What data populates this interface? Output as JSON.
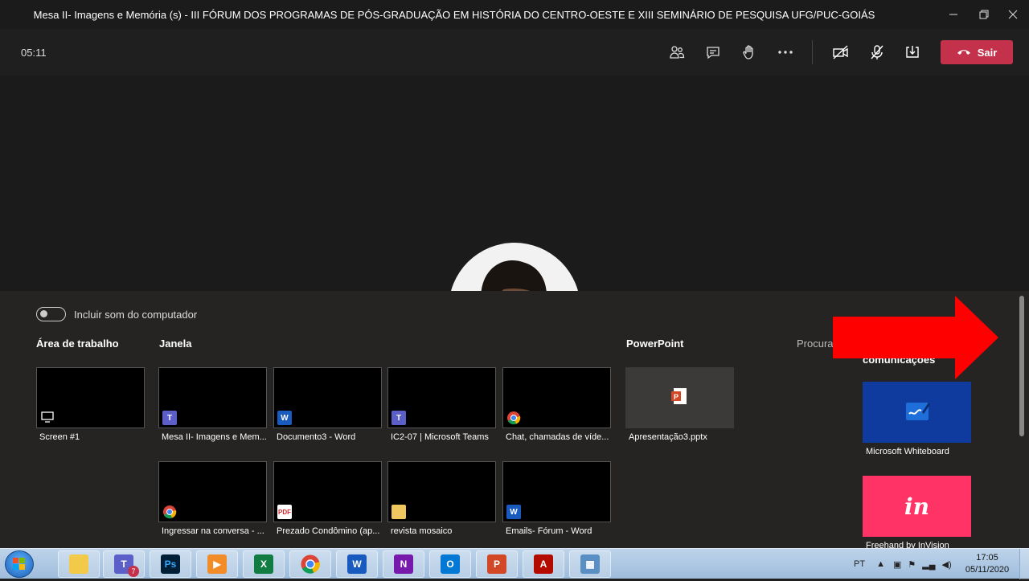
{
  "window": {
    "title": "Mesa II- Imagens e Memória (s) - III FÓRUM DOS PROGRAMAS DE PÓS-GRADUAÇÃO EM HISTÓRIA DO CENTRO-OESTE E XIII SEMINÁRIO DE PESQUISA UFG/PUC-GOIÁS"
  },
  "toolbar": {
    "timer": "05:11",
    "leave_label": "Sair",
    "icons": [
      "participants-icon",
      "chat-icon",
      "raise-hand-icon",
      "more-options-icon",
      "camera-off-icon",
      "mic-off-icon",
      "share-tray-icon"
    ]
  },
  "tray": {
    "include_sound_label": "Incluir som do computador",
    "desktop_label": "Área de trabalho",
    "window_label": "Janela",
    "powerpoint_label": "PowerPoint",
    "browse_label": "Procurar",
    "comm_label": "comunicações",
    "desktop_tiles": [
      {
        "caption": "Screen #1"
      }
    ],
    "window_tiles": [
      {
        "caption": "Mesa II- Imagens e Mem...",
        "app": "teams"
      },
      {
        "caption": "Documento3 - Word",
        "app": "word"
      },
      {
        "caption": "IC2-07 | Microsoft Teams",
        "app": "teams"
      },
      {
        "caption": "Chat, chamadas de víde...",
        "app": "chrome"
      },
      {
        "caption": "Ingressar na conversa - ...",
        "app": "chrome"
      },
      {
        "caption": "Prezado Condômino (ap...",
        "app": "pdf"
      },
      {
        "caption": "revista mosaico",
        "app": "folder"
      },
      {
        "caption": "Emails- Fórum - Word",
        "app": "word"
      }
    ],
    "ppt_tile": {
      "caption": "Apresentação3.pptx"
    },
    "apps": [
      {
        "caption": "Microsoft Whiteboard",
        "color": "#0f3a9e"
      },
      {
        "caption": "Freehand by InVision",
        "color": "#ff3366",
        "logo": "in"
      }
    ]
  },
  "taskbar": {
    "lang": "PT",
    "time": "17:05",
    "date": "05/11/2020",
    "teams_badge": "7",
    "apps": [
      "file-explorer",
      "teams",
      "photoshop",
      "media-player",
      "excel",
      "chrome",
      "word",
      "onenote",
      "outlook",
      "powerpoint",
      "acrobat",
      "photos"
    ]
  },
  "colors": {
    "leave": "#c4314b",
    "arrow": "#ff0000",
    "whiteboard": "#0f3a9e",
    "invision": "#ff3366"
  }
}
